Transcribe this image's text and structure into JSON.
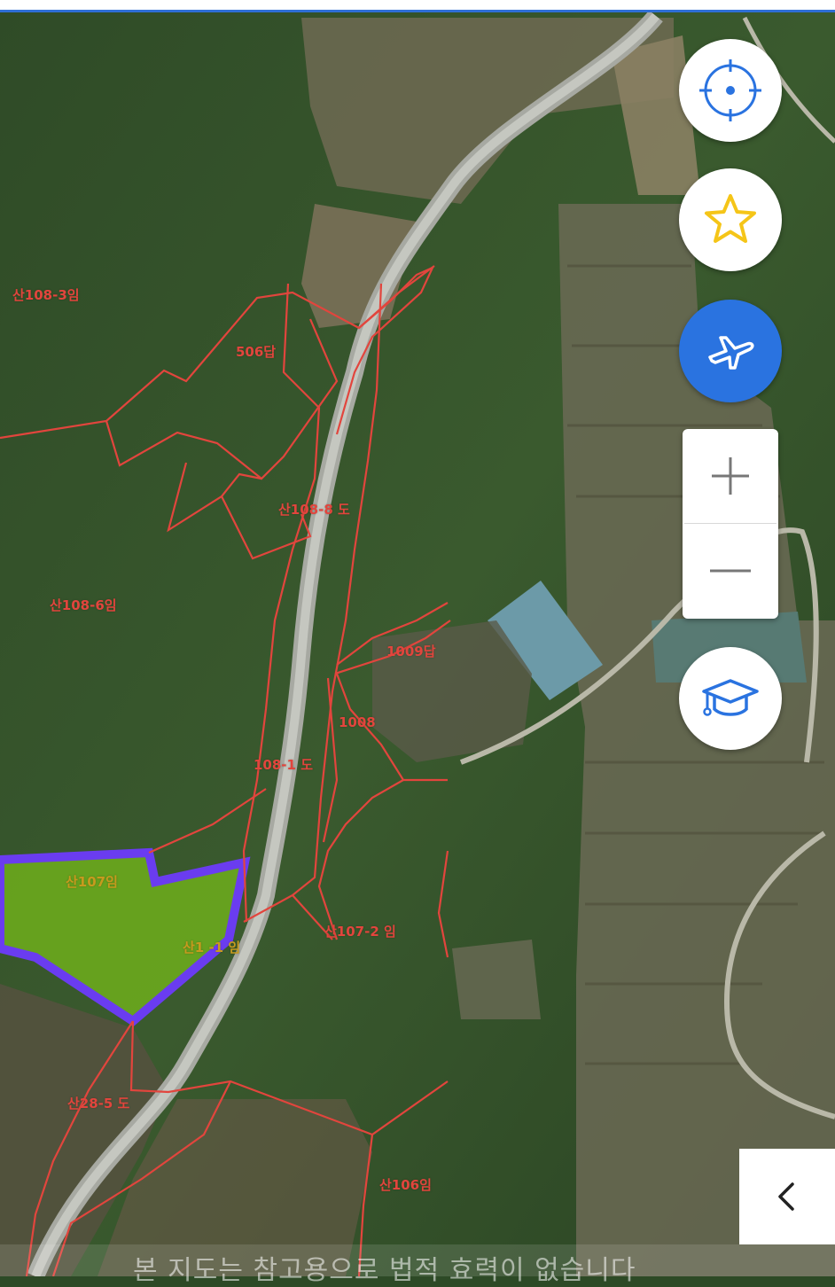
{
  "parcels": [
    {
      "label": "산108-3임"
    },
    {
      "label": "506답"
    },
    {
      "label": "산108-8 도"
    },
    {
      "label": "산108-6임"
    },
    {
      "label": "1009답"
    },
    {
      "label": "1008"
    },
    {
      "label": "108-1 도"
    },
    {
      "label": "산107임"
    },
    {
      "label": "산107-2 임"
    },
    {
      "label": "산1 -1 임"
    },
    {
      "label": "산28-5 도"
    },
    {
      "label": "산106임"
    }
  ],
  "footer_note": "본 지도는 참고용으로 법적 효력이 없습니다",
  "controls": {
    "location": "crosshair-icon",
    "favorite": "star-icon",
    "flight": "airplane-icon",
    "zoom_in": "plus-icon",
    "zoom_out": "minus-icon",
    "learn": "graduation-cap-icon",
    "back": "chevron-left-icon"
  },
  "colors": {
    "parcel_line": "#e2453d",
    "selected_outline": "#6a3cf0",
    "selected_fill": "#6fae1c",
    "accent": "#2a73e0",
    "star": "#f5c518"
  }
}
